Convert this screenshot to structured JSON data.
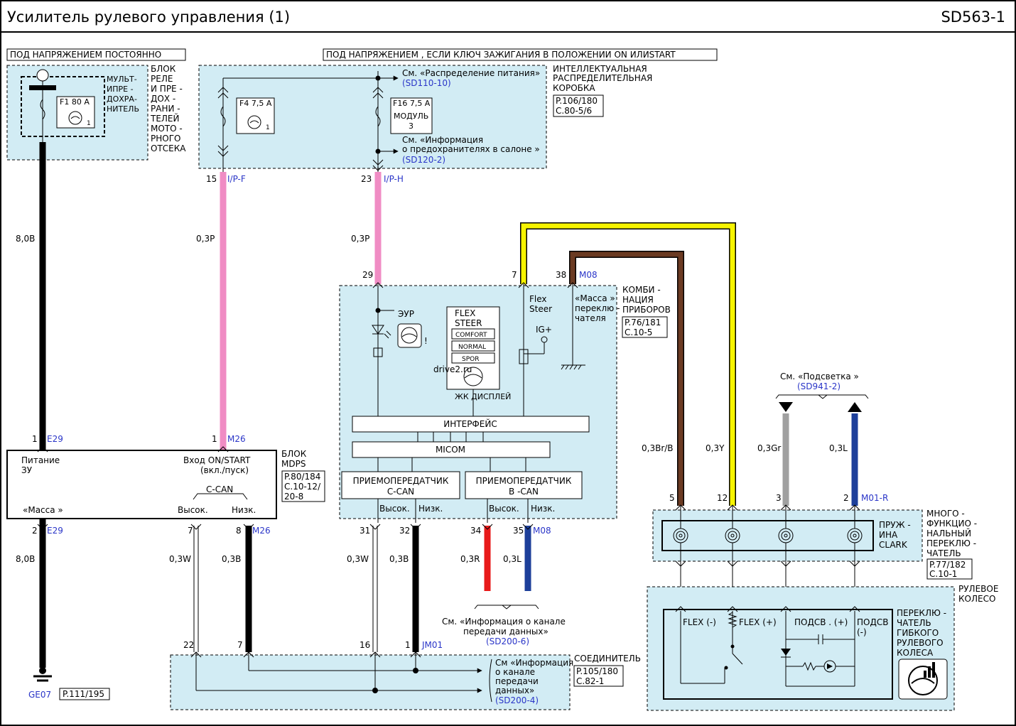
{
  "header": {
    "title": "Усилитель  рулевого  управления (1)",
    "code": "SD563-1"
  },
  "banners": {
    "constant": "ПОД НАПРЯЖЕНИЕМ   ПОСТОЯННО",
    "ignition": "ПОД НАПРЯЖЕНИЕМ  , ЕСЛИ  КЛЮЧ  ЗАЖИГАНИЯ   В  ПОЛОЖЕНИИ  ON  ИЛИSTART"
  },
  "relay_box": {
    "label": [
      "БЛОК",
      "РЕЛЕ",
      "И ПРЕ -",
      "ДОХ -",
      "РАНИ -",
      "ТЕЛЕЙ",
      "МОТО -",
      "РНОГО",
      "ОТСЕКА"
    ],
    "mfuse_label": [
      "МУЛЬТ-",
      "ИПРЕ -",
      "ДОХРА-",
      "НИТЕЛЬ"
    ],
    "fuse": "F1 80 A"
  },
  "smart_box": {
    "label": [
      "ИНТЕЛЛЕКТУАЛЬНАЯ",
      "РАСПРЕДЕЛИТЕЛЬНАЯ",
      "КОРОБКА"
    ],
    "ref": [
      "P.106/180",
      "C.80-5/6"
    ],
    "fuse_f4": "F4 7,5 A",
    "fuse_f16": "F16 7,5 A",
    "module": [
      "МОДУЛЬ",
      "3"
    ],
    "see_power": "См. «Распределение питания»",
    "see_power_ref": "(SD110-10)",
    "see_fuses": [
      "См. «Информация",
      "о предохранителях в салоне »"
    ],
    "see_fuses_ref": "(SD120-2)"
  },
  "pins": {
    "p15": "15",
    "ip_f": "I/P-F",
    "p23": "23",
    "ip_h": "I/P-H",
    "p1a": "1",
    "e29": "E29",
    "p1b": "1",
    "m26": "M26",
    "p2": "2",
    "e29b": "E29",
    "p7": "7",
    "p8": "8",
    "m26b": "M26",
    "p29": "29",
    "p7c": "7",
    "p38": "38",
    "m08": "M08",
    "p31": "31",
    "p32": "32",
    "p34": "34",
    "p35": "35",
    "m08b": "M08",
    "p22": "22",
    "p7d": "7",
    "p16": "16",
    "p1c": "1",
    "jm01": "JM01",
    "p5": "5",
    "p12": "12",
    "p3": "3",
    "p2b": "2",
    "m01r": "M01-R",
    "s3": "3",
    "s5": "5",
    "s2": "2",
    "s1": "1"
  },
  "wires": {
    "w80b": "8,0B",
    "w03p_a": "0,3P",
    "w03p_b": "0,3P",
    "w80b_b": "8,0B",
    "w03w_a": "0,3W",
    "w03b_a": "0,3B",
    "w03w_b": "0,3W",
    "w03b_b": "0,3B",
    "w03r": "0,3R",
    "w03l_a": "0,3L",
    "w03brb": "0,3Br/B",
    "w03y": "0,3Y",
    "w03gr": "0,3Gr",
    "w03l_b": "0,3L"
  },
  "mdps": {
    "label": [
      "БЛОК",
      "MDPS"
    ],
    "ref": [
      "P.80/184",
      "C.10-12/",
      "20-8"
    ],
    "power": [
      "Питание",
      "ЗУ"
    ],
    "input": [
      "Вход ON/START",
      "(вкл./пуск)"
    ],
    "ground": "«Масса »",
    "ccan": "C-CAN",
    "high": "Высок.",
    "low": "Низк."
  },
  "cluster": {
    "label": [
      "КОМБИ -",
      "НАЦИЯ",
      "ПРИБОРОВ"
    ],
    "ref": [
      "P.76/181",
      "C.10-5"
    ],
    "eur": "ЭУР",
    "flex_title": [
      "FLEX",
      "STEER"
    ],
    "modes": [
      "COMFORT",
      "NORMAL",
      "SPOR"
    ],
    "lcd": "ЖК ДИСПЛЕЙ",
    "flex_steer": [
      "Flex",
      "Steer"
    ],
    "ig": "IG+",
    "switch_ground": [
      "«Масса »",
      "переклю -",
      "чателя"
    ],
    "interface": "ИНТЕРФЕЙС",
    "micom": "MICOM",
    "trx_c": [
      "ПРИЕМОПЕРЕДАТЧИК",
      "C-CAN"
    ],
    "trx_b": [
      "ПРИЕМОПЕРЕДАТЧИК",
      "B -CAN"
    ],
    "high": "Высок.",
    "low": "Низк.",
    "high2": "Высок.",
    "low2": "Низк."
  },
  "backlight_ref": {
    "text": "См. «Подсветка »",
    "ref": "(SD941-2)"
  },
  "can_ref": {
    "text": [
      "См. «Информация о канале",
      "передачи данных»"
    ],
    "ref": "(SD200-6)"
  },
  "multi_switch": {
    "label": [
      "МНОГО -",
      "ФУНКЦИО -",
      "НАЛЬНЫЙ",
      "ПЕРЕКЛЮ -",
      "ЧАТЕЛЬ"
    ],
    "ref": [
      "P.77/182",
      "C.10-1"
    ],
    "clock": [
      "ПРУЖ -",
      "ИНА",
      "CLARK"
    ]
  },
  "wheel": {
    "label": [
      "РУЛЕВОЕ",
      "КОЛЕСО"
    ],
    "switch_label": [
      "ПЕРЕКЛЮ -",
      "ЧАТЕЛЬ",
      "ГИБКОГО",
      "РУЛЕВОГО",
      "КОЛЕСА"
    ],
    "flex_minus": "FLEX (-)",
    "flex_plus": "FLEX (+)",
    "ill_plus": "ПОДСВ . (+)",
    "ill_minus": [
      "ПОДСВ .",
      "(-)"
    ]
  },
  "joint": {
    "label": "СОЕДИНИТЕЛЬ",
    "ref": [
      "P.105/180",
      "C.82-1"
    ],
    "see": [
      "См «Информация",
      "о канале",
      "передачи",
      "данных»"
    ],
    "see_ref": "(SD200-4)"
  },
  "ground": {
    "code": "GE07",
    "ref": "P.111/195"
  },
  "watermark": "drive2.ru",
  "colors": {
    "panel": "#d2ecf4",
    "pink": "#f08cc4",
    "brown": "#6b3a22",
    "yellow": "#f7f400",
    "gray": "#a0a0a0",
    "blue": "#1d3f9a",
    "red": "#e81a1a",
    "label_blue": "#2a35c8"
  }
}
